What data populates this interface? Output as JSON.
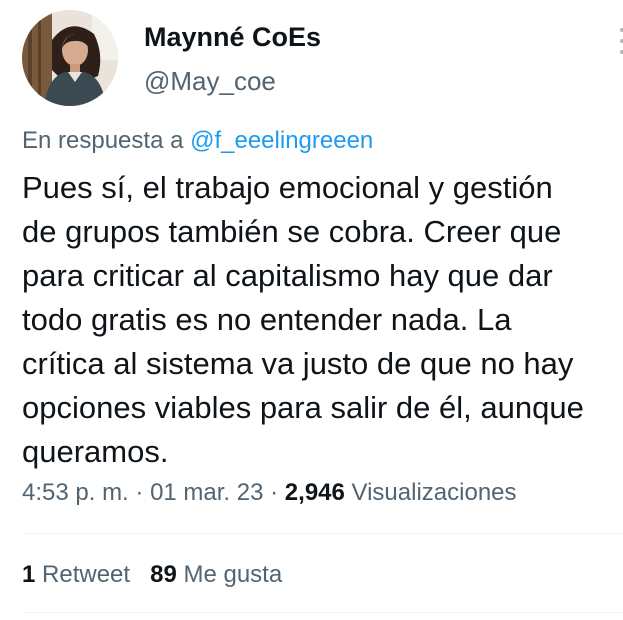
{
  "author": {
    "display_name": "Maynné CoEs",
    "handle": "@May_coe"
  },
  "reply": {
    "prefix": "En respuesta a ",
    "to_handle": "@f_eeelingreeen"
  },
  "tweet": {
    "lines": [
      "Pues sí, el trabajo emocional y gestión",
      "de grupos también se cobra. Creer que",
      "para criticar al capitalismo hay que dar",
      "todo gratis es no entender nada. La",
      "crítica al sistema va justo de que no hay",
      "opciones viables para salir de él, aunque",
      "queramos."
    ]
  },
  "meta": {
    "time": "4:53 p. m.",
    "sep1": " · ",
    "date": "01 mar. 23",
    "sep2": " · ",
    "views_count": "2,946",
    "views_label": " Visualizaciones"
  },
  "stats": {
    "retweets_count": "1",
    "retweets_label": " Retweet",
    "likes_count": "89",
    "likes_label": " Me gusta"
  },
  "icons": {
    "more": "more-options-icon"
  },
  "colors": {
    "text": "#0f1419",
    "secondary": "#536471",
    "link": "#1d9bf0",
    "divider": "#eff3f4"
  }
}
